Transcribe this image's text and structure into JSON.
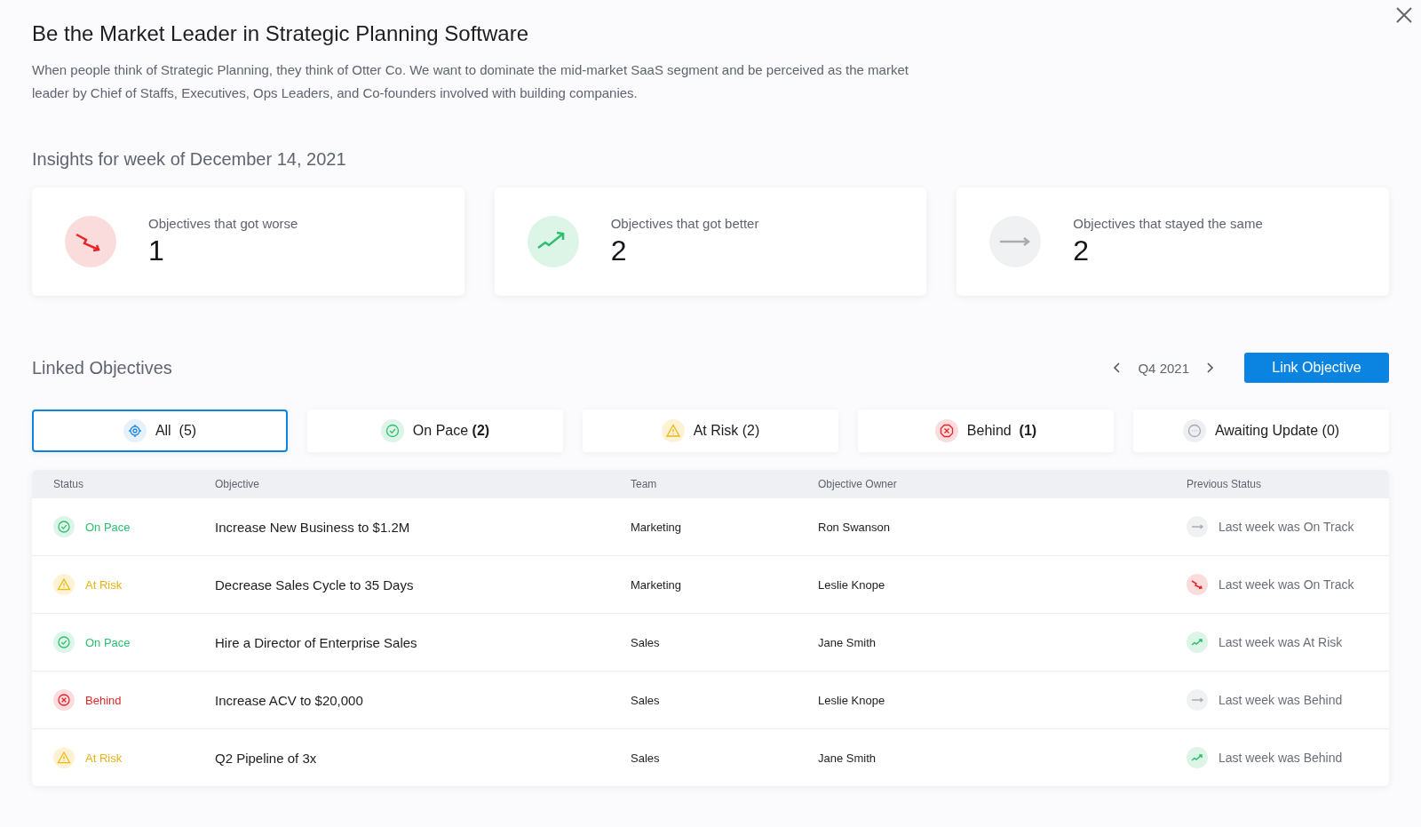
{
  "header": {
    "title": "Be the Market Leader in Strategic Planning Software",
    "description": "When people think of Strategic Planning, they think of Otter Co. We want to dominate the mid-market SaaS segment and be perceived as the market leader by Chief of Staffs, Executives, Ops Leaders, and Co-founders involved with building companies."
  },
  "insights": {
    "title": "Insights for week of December 14, 2021",
    "cards": [
      {
        "kind": "worse",
        "label": "Objectives that got worse",
        "value": "1"
      },
      {
        "kind": "better",
        "label": "Objectives that got better",
        "value": "2"
      },
      {
        "kind": "same",
        "label": "Objectives that stayed the same",
        "value": "2"
      }
    ]
  },
  "linked": {
    "title": "Linked Objectives",
    "period": "Q4 2021",
    "action": "Link Objective"
  },
  "filters": [
    {
      "kind": "all",
      "label": "All  (5)",
      "selected": true
    },
    {
      "kind": "on_pace",
      "label": "On Pace **(2)**",
      "selected": false
    },
    {
      "kind": "at_risk",
      "label": "At Risk (2)",
      "selected": false
    },
    {
      "kind": "behind",
      "label": "Behind  **(1)**",
      "selected": false
    },
    {
      "kind": "awaiting",
      "label": "Awaiting Update (0)",
      "selected": false
    }
  ],
  "table": {
    "columns": [
      "Status",
      "Objective",
      "Team",
      "Objective Owner",
      "Previous Status"
    ],
    "rows": [
      {
        "status": {
          "kind": "on_pace",
          "label": "On Pace"
        },
        "objective": "Increase New Business to $1.2M",
        "team": "Marketing",
        "owner": "Ron Swanson",
        "previous": {
          "kind": "same",
          "label": "Last week was On Track"
        }
      },
      {
        "status": {
          "kind": "at_risk",
          "label": "At Risk"
        },
        "objective": "Decrease Sales Cycle to 35 Days",
        "team": "Marketing",
        "owner": "Leslie Knope",
        "previous": {
          "kind": "worse",
          "label": "Last week was On Track"
        }
      },
      {
        "status": {
          "kind": "on_pace",
          "label": "On Pace"
        },
        "objective": "Hire a Director of Enterprise Sales",
        "team": "Sales",
        "owner": "Jane Smith",
        "previous": {
          "kind": "better",
          "label": "Last week was At Risk"
        }
      },
      {
        "status": {
          "kind": "behind",
          "label": "Behind"
        },
        "objective": "Increase ACV to $20,000",
        "team": "Sales",
        "owner": "Leslie Knope",
        "previous": {
          "kind": "same",
          "label": "Last week was Behind"
        }
      },
      {
        "status": {
          "kind": "at_risk",
          "label": "At Risk"
        },
        "objective": "Q2 Pipeline of 3x",
        "team": "Sales",
        "owner": "Jane Smith",
        "previous": {
          "kind": "better",
          "label": "Last week was Behind"
        }
      }
    ]
  }
}
